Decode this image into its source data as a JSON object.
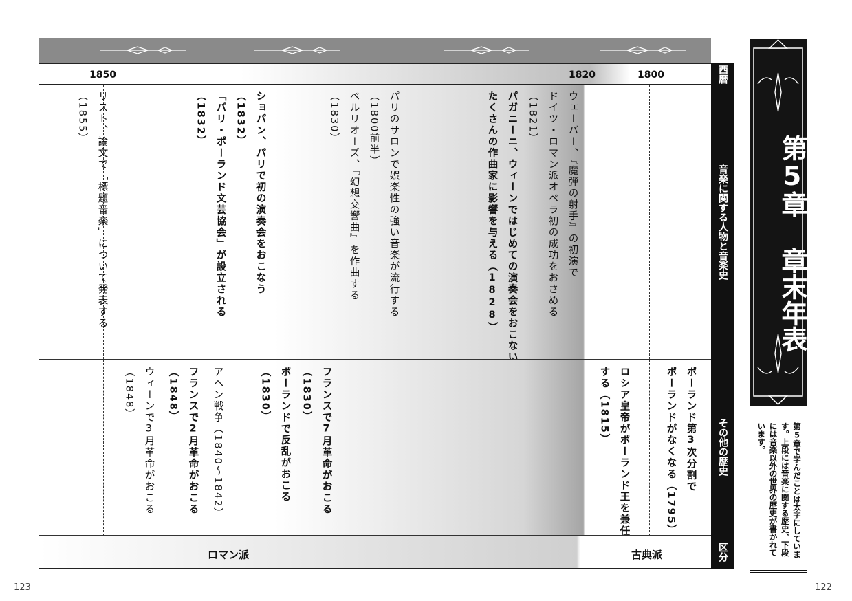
{
  "years": {
    "y1850": "1850",
    "y1820": "1820",
    "y1800": "1800"
  },
  "side_labels": {
    "seireki": "西暦",
    "music": "音楽に関する人物と音楽史",
    "other": "その他の歴史",
    "kubun": "区分"
  },
  "chapter": {
    "title": "第5章 章末年表",
    "note": "第5章で学んだことは太字にしています。上段には音楽に関する歴史、下段には音楽以外の世界の歴史が書かれています。"
  },
  "upper_entries": [
    {
      "text": "ウェーバー、『魔弾の射手』の初演で",
      "bold": false
    },
    {
      "text": "ドイツ・ロマン派オペラ初の成功をおさめる",
      "bold": false
    },
    {
      "text": "（1821）",
      "bold": false
    },
    {
      "text": "パガニーニ、ウィーンではじめての演奏会をおこない、",
      "bold": true
    },
    {
      "text": "たくさんの作曲家に影響を与える（1828）",
      "bold": true
    },
    {
      "text": "パリのサロンで娯楽性の強い音楽が流行する",
      "bold": false
    },
    {
      "text": "（1800前半）",
      "bold": false
    },
    {
      "text": "ベルリオーズ、『幻想交響曲』を作曲する",
      "bold": false
    },
    {
      "text": "（1830）",
      "bold": false
    },
    {
      "text": "ショパン、パリで初の演奏会をおこなう",
      "bold": true
    },
    {
      "text": "（1832）",
      "bold": true
    },
    {
      "text": "「パリ・ポーランド文芸協会」が設立される",
      "bold": true
    },
    {
      "text": "（1832）",
      "bold": true
    },
    {
      "text": "リスト、論文で「標題音楽」について発表する",
      "bold": false
    },
    {
      "text": "（1855）",
      "bold": false
    }
  ],
  "lower_entries": [
    {
      "text": "ポーランド第3次分割で",
      "bold": true
    },
    {
      "text": "ポーランドがなくなる（1795）",
      "bold": true
    },
    {
      "text": "ロシア皇帝がポーランド王を兼任",
      "bold": true
    },
    {
      "text": "する（1815）",
      "bold": true
    },
    {
      "text": "フランスで7月革命がおこる",
      "bold": true
    },
    {
      "text": "（1830）",
      "bold": true
    },
    {
      "text": "ポーランドで反乱がおこる",
      "bold": true
    },
    {
      "text": "（1830）",
      "bold": true
    },
    {
      "text": "アヘン戦争（1840〜1842）",
      "bold": false
    },
    {
      "text": "フランスで2月革命がおこる",
      "bold": true
    },
    {
      "text": "（1848）",
      "bold": true
    },
    {
      "text": "ウィーンで3月革命がおこる",
      "bold": false
    },
    {
      "text": "（1848）",
      "bold": false
    }
  ],
  "eras": {
    "romantic": "ロマン派",
    "classical": "古典派"
  },
  "page_numbers": {
    "left": "123",
    "right": "122"
  }
}
